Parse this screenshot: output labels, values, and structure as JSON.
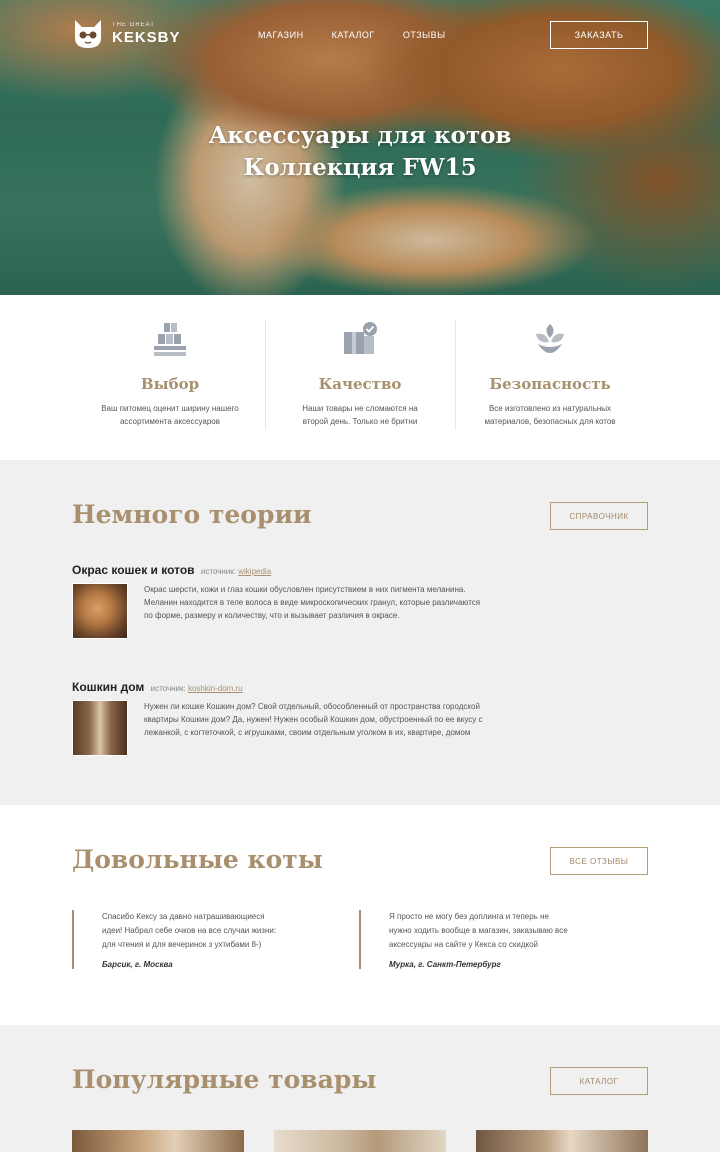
{
  "header": {
    "logo_small": "THE GREAT",
    "logo_big": "KEKSBY",
    "menu": [
      "МАГАЗИН",
      "КАТАЛОГ",
      "ОТЗЫВЫ"
    ],
    "order_button": "ЗАКАЗАТЬ"
  },
  "hero": {
    "title_line1": "Аксессуары для котов",
    "title_line2": "Коллекция FW15"
  },
  "features": [
    {
      "icon": "boxes-icon",
      "title": "Выбор",
      "text_line1": "Ваш питомец оценит ширину нашего",
      "text_line2": "ассортимента аксессуаров"
    },
    {
      "icon": "quality-box-icon",
      "title": "Качество",
      "text_line1": "Наши товары не сломаются на",
      "text_line2": "второй день.  Только не бритни"
    },
    {
      "icon": "leaf-icon",
      "title": "Безопасность",
      "text_line1": "Все изготовлено из натуральных",
      "text_line2": "материалов, безопасных для котов"
    }
  ],
  "theory": {
    "title": "Немного теории",
    "button": "СПРАВОЧНИК",
    "articles": [
      {
        "title": "Окрас кошек и котов",
        "source_label": "источник:",
        "source_link": "wikipedia",
        "lines": [
          "Окрас шерсти, кожи и глаз кошки обусловлен присутствием в них пигмента меланина.",
          "Меланин находится в теле волоса в виде микроскопических гранул, которые различаются",
          "по форме, размеру и количеству, что и вызывает различия в окрасе."
        ]
      },
      {
        "title": "Кошкин дом",
        "source_label": "источник:",
        "source_link": "koshkin-dom.ru",
        "lines": [
          "Нужен ли кошке Кошкин дом? Свой отдельный, обособленный от пространства городской",
          "квартиры Кошкин дом? Да, нужен! Нужен особый Кошкин дом, обустроенный по ее вкусу с",
          "лежанкой, с когтеточкой, с игрушками, своим отдельным уголком в их, квартире, домом"
        ]
      }
    ]
  },
  "reviews": {
    "title": "Довольные коты",
    "button": "ВСЕ ОТЗЫВЫ",
    "items": [
      {
        "lines": [
          "Спасибо Кексу за давно натрашивающиеся",
          "идеи! Набрал себе очков на все случаи жизни:",
          "для чтения и для вечеринок з ухтибами 8-)"
        ],
        "author": "Барсик, г. Москва"
      },
      {
        "lines": [
          "Я просто не могу без доплинга и теперь не",
          "нужно ходить вообще в магазин, заказываю все",
          "аксессуары на сайте у Кекса со скидкой"
        ],
        "author": "Мурка, г. Санкт-Петербург"
      }
    ]
  },
  "products": {
    "title": "Популярные товары",
    "button": "КАТАЛОГ"
  }
}
